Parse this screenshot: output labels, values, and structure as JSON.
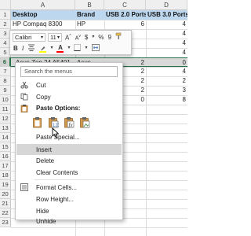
{
  "columns": [
    "A",
    "B",
    "C",
    "D"
  ],
  "rows": [
    "1",
    "2",
    "3",
    "4",
    "5",
    "6",
    "7",
    "8",
    "9",
    "10",
    "11",
    "12",
    "13",
    "14",
    "15",
    "16",
    "17",
    "18",
    "19",
    "20",
    "21",
    "22",
    "23"
  ],
  "table": {
    "header": [
      "Desktop",
      "Brand",
      "USB 2.0 Ports",
      "USB 3.0 Ports"
    ],
    "row2": [
      "HP Compaq 8300",
      "HP",
      "6",
      "4"
    ],
    "row6": [
      "Asus Zen 24 A5401",
      "Asus",
      "2",
      "0"
    ],
    "c_vals": [
      "6",
      "2",
      "2",
      "2",
      "2",
      "0"
    ],
    "d_vals": [
      "4",
      "4",
      "4",
      "4",
      "0",
      "4",
      "2",
      "3",
      "8"
    ]
  },
  "mini_toolbar": {
    "font_name": "Calibri",
    "font_size": "11",
    "grow": "A",
    "shrink": "A",
    "currency": "$",
    "percent": "%",
    "comma": "9",
    "bold": "B",
    "italic": "I",
    "highlight_color": "#ffff00",
    "font_color": "#ff0000"
  },
  "context_menu": {
    "search_placeholder": "Search the menus",
    "items": {
      "cut": "Cut",
      "copy": "Copy",
      "paste_options": "Paste Options:",
      "paste_special": "Paste Special...",
      "insert": "Insert",
      "delete": "Delete",
      "clear_contents": "Clear Contents",
      "format_cells": "Format Cells...",
      "row_height": "Row Height...",
      "hide": "Hide",
      "unhide": "Unhide"
    }
  },
  "colors": {
    "accent": "#217346",
    "header_fill": "#bdd7ee",
    "menu_hover": "#d6d6d6"
  }
}
